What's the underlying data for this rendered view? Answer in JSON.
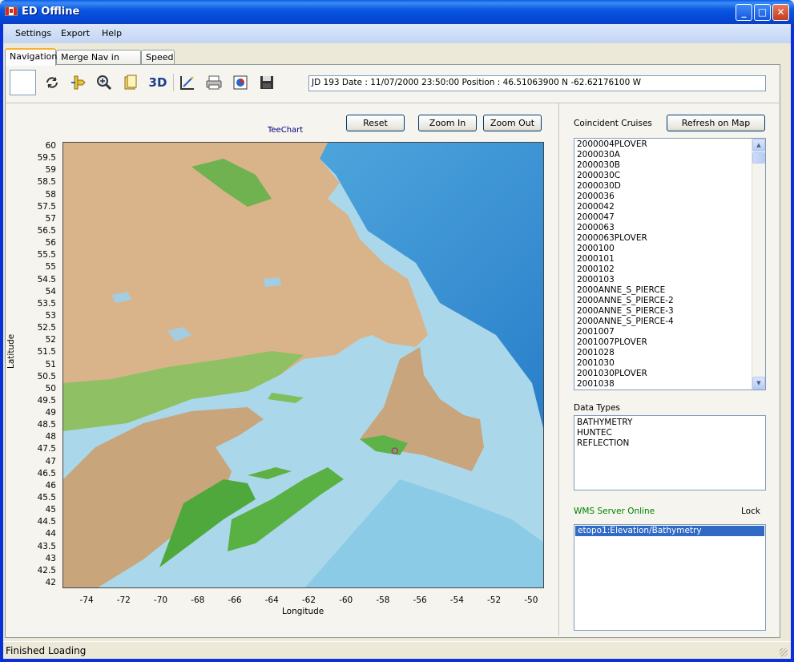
{
  "window": {
    "title": "ED Offline"
  },
  "menu": [
    "Settings",
    "Export",
    "Help"
  ],
  "tabs": [
    "Navigation",
    "Merge Nav in SEGY",
    "Speed"
  ],
  "toolbar": {
    "tools": [
      "refresh-icon",
      "pan-icon",
      "zoom-icon",
      "layers-icon",
      "3d-icon",
      "chart-edit-icon",
      "print-icon",
      "export-image-icon",
      "save-icon"
    ],
    "three_d_label": "3D",
    "status": "JD 193 Date : 11/07/2000 23:50:00  Position : 46.51063900 N -62.62176100 W"
  },
  "chart": {
    "title": "TeeChart",
    "buttons": {
      "reset": "Reset",
      "zoom_in": "Zoom In",
      "zoom_out": "Zoom Out"
    },
    "ylabel": "Latitude",
    "xlabel": "Longitude",
    "yticks": [
      "60",
      "59.5",
      "59",
      "58.5",
      "58",
      "57.5",
      "57",
      "56.5",
      "56",
      "55.5",
      "55",
      "54.5",
      "54",
      "53.5",
      "53",
      "52.5",
      "52",
      "51.5",
      "51",
      "50.5",
      "50",
      "49.5",
      "49",
      "48.5",
      "48",
      "47.5",
      "47",
      "46.5",
      "46",
      "45.5",
      "45",
      "44.5",
      "44",
      "43.5",
      "43",
      "42.5",
      "42"
    ],
    "xticks": [
      "-74",
      "-72",
      "-70",
      "-68",
      "-66",
      "-64",
      "-62",
      "-60",
      "-58",
      "-56",
      "-54",
      "-52",
      "-50"
    ],
    "marker": {
      "lon": -57.4,
      "lat": 47.5
    }
  },
  "right": {
    "cruises_label": "Coincident Cruises",
    "refresh_button": "Refresh on Map",
    "cruises": [
      "2000004PLOVER",
      "2000030A",
      "2000030B",
      "2000030C",
      "2000030D",
      "2000036",
      "2000042",
      "2000047",
      "2000063",
      "2000063PLOVER",
      "2000100",
      "2000101",
      "2000102",
      "2000103",
      "2000ANNE_S_PIERCE",
      "2000ANNE_S_PIERCE-2",
      "2000ANNE_S_PIERCE-3",
      "2000ANNE_S_PIERCE-4",
      "2001007",
      "2001007PLOVER",
      "2001028",
      "2001030",
      "2001030PLOVER",
      "2001038"
    ],
    "data_types_label": "Data Types",
    "data_types": [
      "BATHYMETRY",
      "HUNTEC",
      "REFLECTION"
    ],
    "wms_label": "WMS Server Online",
    "lock_label": "Lock",
    "wms_layers": [
      "etopo1:Elevation/Bathymetry"
    ]
  },
  "statusbar": {
    "text": "Finished Loading"
  },
  "colors": {
    "land": "#d9b48a",
    "land_low": "#62b34a",
    "shelf": "#a9d8e8",
    "deep": "#2e82c8"
  }
}
